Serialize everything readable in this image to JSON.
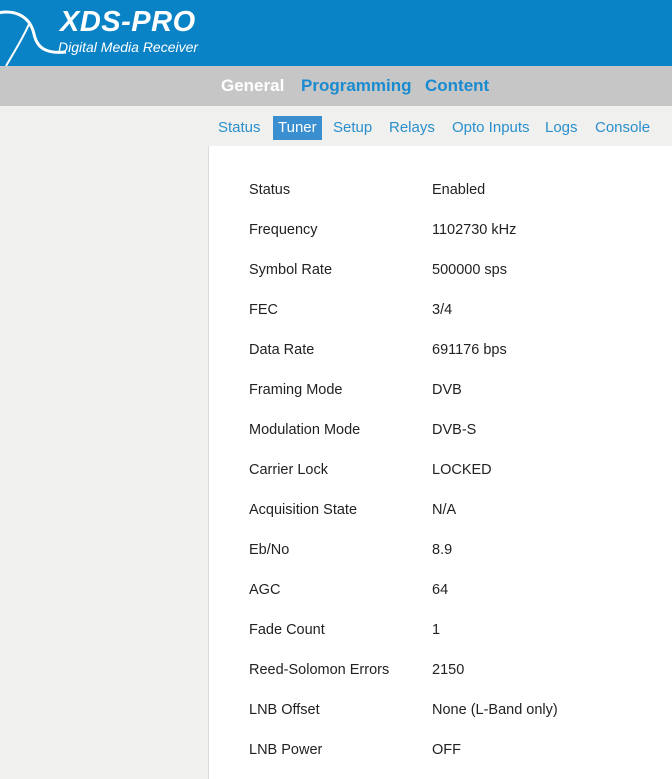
{
  "brand": {
    "title": "XDS-PRO",
    "subtitle": "Digital Media Receiver"
  },
  "colors": {
    "header_bg": "#0a82c6",
    "nav_bg": "#c6c6c6",
    "link": "#1a8bd0",
    "active_tab_bg": "#3a8fd0"
  },
  "main_nav": {
    "items": [
      {
        "label": "General",
        "active": true
      },
      {
        "label": "Programming",
        "active": false
      },
      {
        "label": "Content",
        "active": false
      }
    ]
  },
  "sub_nav": {
    "tabs": [
      {
        "label": "Status",
        "active": false
      },
      {
        "label": "Tuner",
        "active": true
      },
      {
        "label": "Setup",
        "active": false
      },
      {
        "label": "Relays",
        "active": false
      },
      {
        "label": "Opto Inputs",
        "active": false
      },
      {
        "label": "Logs",
        "active": false
      },
      {
        "label": "Console",
        "active": false
      }
    ]
  },
  "tuner": {
    "rows": [
      {
        "label": "Status",
        "value": "Enabled"
      },
      {
        "label": "Frequency",
        "value": "1102730 kHz"
      },
      {
        "label": "Symbol Rate",
        "value": "500000 sps"
      },
      {
        "label": "FEC",
        "value": "3/4"
      },
      {
        "label": "Data Rate",
        "value": "691176 bps"
      },
      {
        "label": "Framing Mode",
        "value": "DVB"
      },
      {
        "label": "Modulation Mode",
        "value": "DVB-S"
      },
      {
        "label": "Carrier Lock",
        "value": "LOCKED"
      },
      {
        "label": "Acquisition State",
        "value": "N/A"
      },
      {
        "label": "Eb/No",
        "value": "8.9"
      },
      {
        "label": "AGC",
        "value": "64"
      },
      {
        "label": "Fade Count",
        "value": "1"
      },
      {
        "label": "Reed-Solomon Errors",
        "value": "2150"
      },
      {
        "label": "LNB Offset",
        "value": "None (L-Band only)"
      },
      {
        "label": "LNB Power",
        "value": "OFF"
      }
    ]
  }
}
